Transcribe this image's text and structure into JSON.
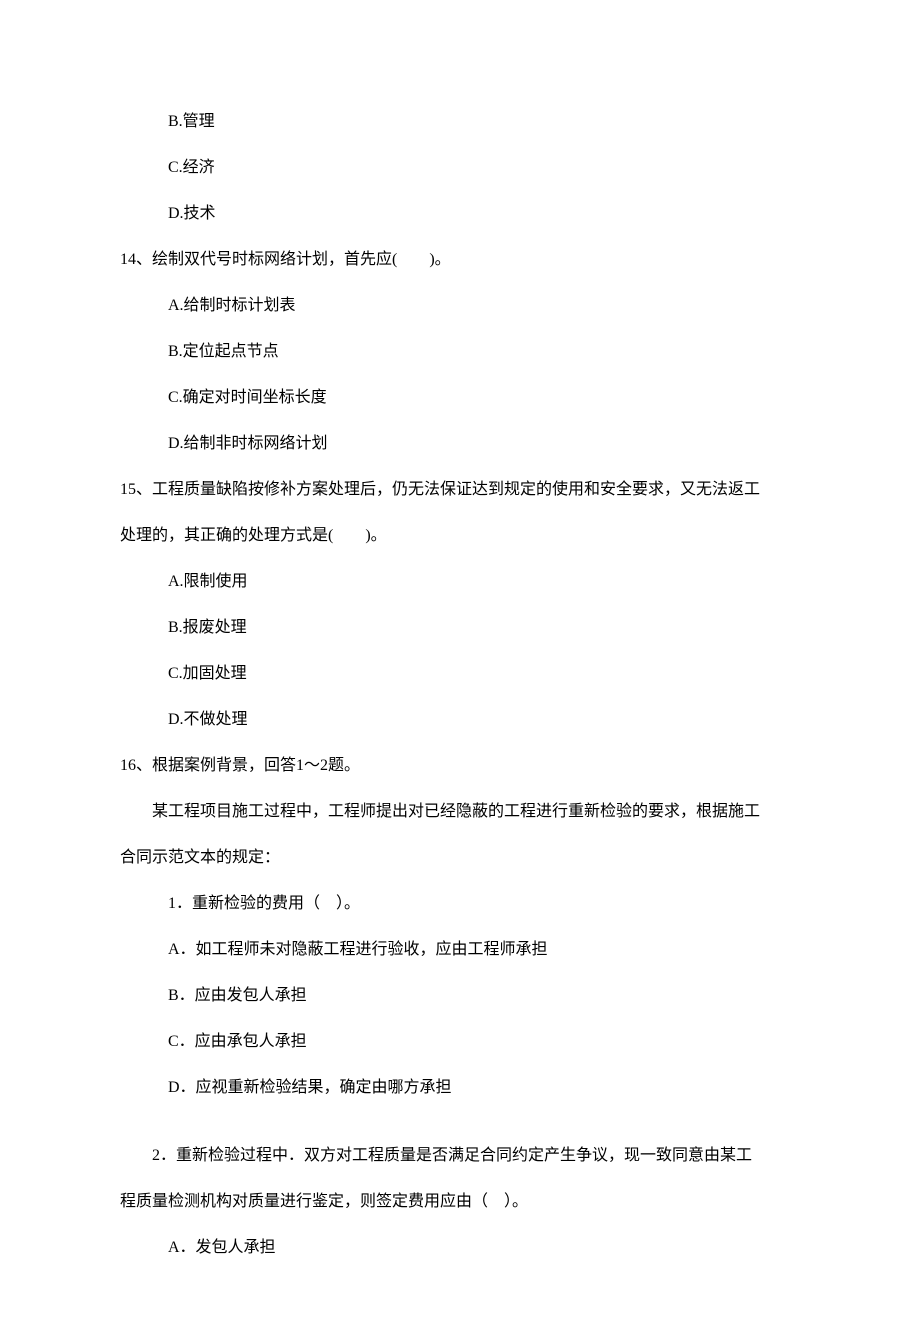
{
  "q13": {
    "optB": "B.管理",
    "optC": "C.经济",
    "optD": "D.技术"
  },
  "q14": {
    "stem": "14、绘制双代号时标网络计划，首先应(　　)。",
    "optA": "A.给制时标计划表",
    "optB": "B.定位起点节点",
    "optC": "C.确定对时间坐标长度",
    "optD": "D.给制非时标网络计划"
  },
  "q15": {
    "stem_line1": "15、工程质量缺陷按修补方案处理后，仍无法保证达到规定的使用和安全要求，又无法返工",
    "stem_line2": "处理的，其正确的处理方式是(　　)。",
    "optA": "A.限制使用",
    "optB": "B.报废处理",
    "optC": "C.加固处理",
    "optD": "D.不做处理"
  },
  "q16": {
    "stem": "16、根据案例背景，回答1～2题。",
    "bg_line1": "某工程项目施工过程中，工程师提出对已经隐蔽的工程进行重新检验的要求，根据施工",
    "bg_line2": "合同示范文本的规定：",
    "sub1": {
      "stem": "1．重新检验的费用（　）。",
      "optA": "A．如工程师未对隐蔽工程进行验收，应由工程师承担",
      "optB": "B．应由发包人承担",
      "optC": "C．应由承包人承担",
      "optD": "D．应视重新检验结果，确定由哪方承担"
    },
    "sub2": {
      "stem_line1": "2．重新检验过程中．双方对工程质量是否满足合同约定产生争议，现一致同意由某工",
      "stem_line2": "程质量检测机构对质量进行鉴定，则签定费用应由（　）。",
      "optA": "A．发包人承担"
    }
  }
}
